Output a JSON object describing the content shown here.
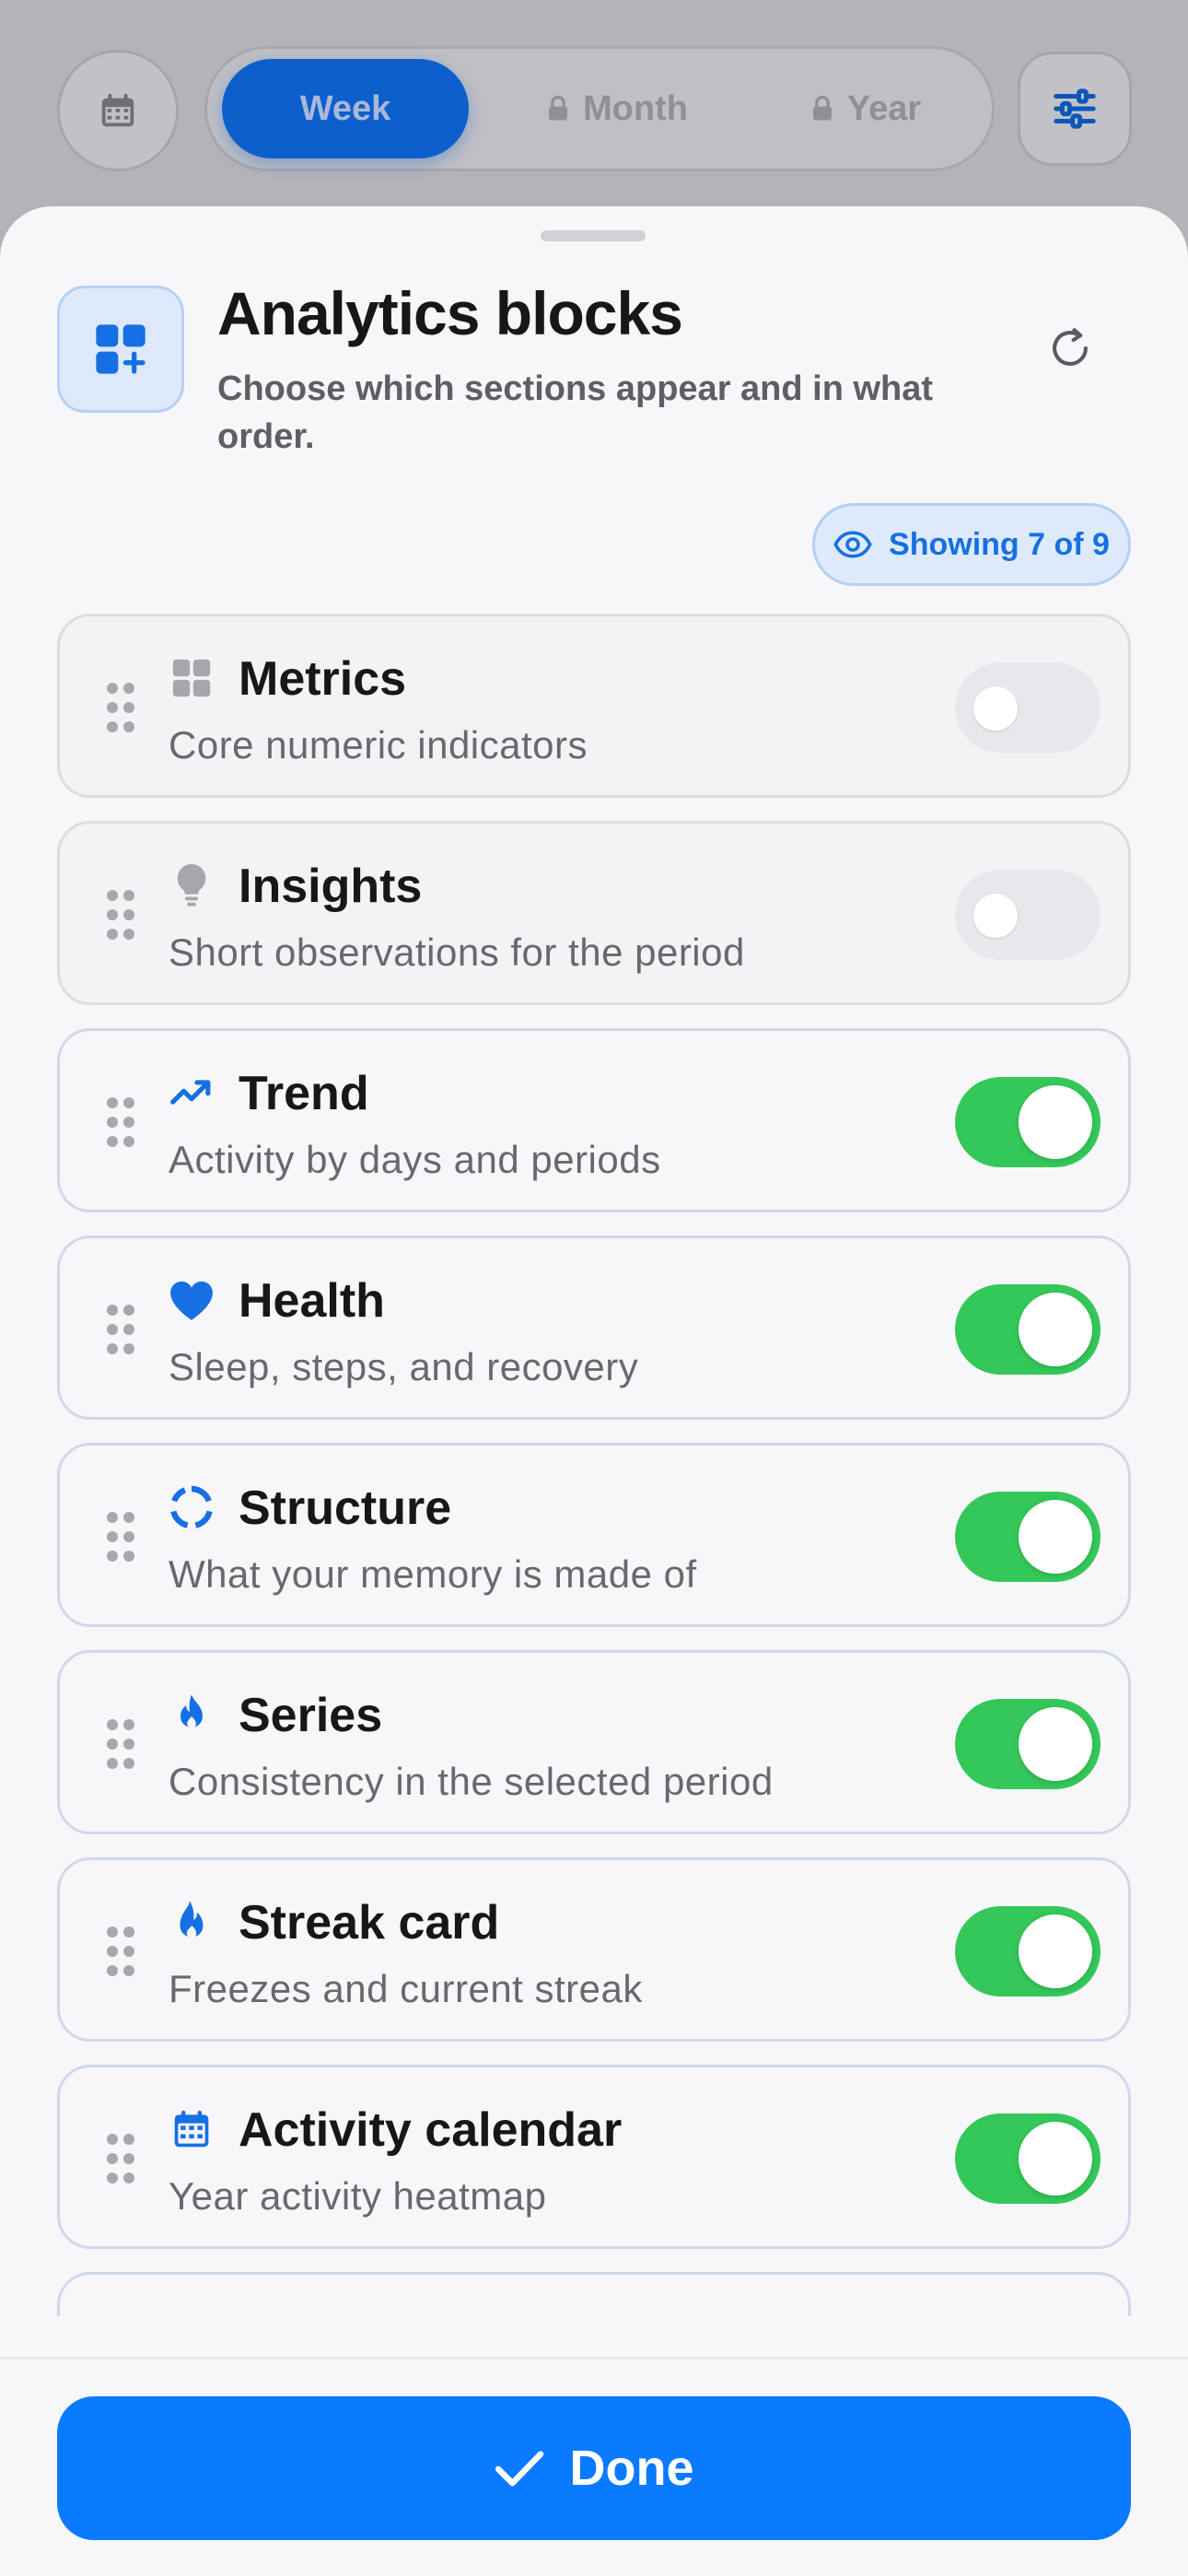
{
  "topbar": {
    "tabs": [
      {
        "label": "Week",
        "selected": true,
        "locked": false
      },
      {
        "label": "Month",
        "selected": false,
        "locked": true
      },
      {
        "label": "Year",
        "selected": false,
        "locked": true
      }
    ]
  },
  "sheet": {
    "title": "Analytics blocks",
    "subtitle": "Choose which sections appear and in what order.",
    "showing_label": "Showing 7 of 9",
    "done_label": "Done"
  },
  "blocks": [
    {
      "title": "Metrics",
      "description": "Core numeric indicators",
      "icon": "grid-icon",
      "enabled": false
    },
    {
      "title": "Insights",
      "description": "Short observations for the period",
      "icon": "lightbulb-icon",
      "enabled": false
    },
    {
      "title": "Trend",
      "description": "Activity by days and periods",
      "icon": "trend-line-icon",
      "enabled": true
    },
    {
      "title": "Health",
      "description": "Sleep, steps, and recovery",
      "icon": "heart-icon",
      "enabled": true
    },
    {
      "title": "Structure",
      "description": "What your memory is made of",
      "icon": "donut-icon",
      "enabled": true
    },
    {
      "title": "Series",
      "description": "Consistency in the selected period",
      "icon": "flame-icon",
      "enabled": true
    },
    {
      "title": "Streak card",
      "description": "Freezes and current streak",
      "icon": "flame-outline-icon",
      "enabled": true
    },
    {
      "title": "Activity calendar",
      "description": "Year activity heatmap",
      "icon": "calendar-icon",
      "enabled": true
    }
  ],
  "colors": {
    "accent": "#0a7aff",
    "toggle_on": "#34c759",
    "toggle_off": "#e8e8ec",
    "icon_inactive": "#a6a6ab"
  }
}
